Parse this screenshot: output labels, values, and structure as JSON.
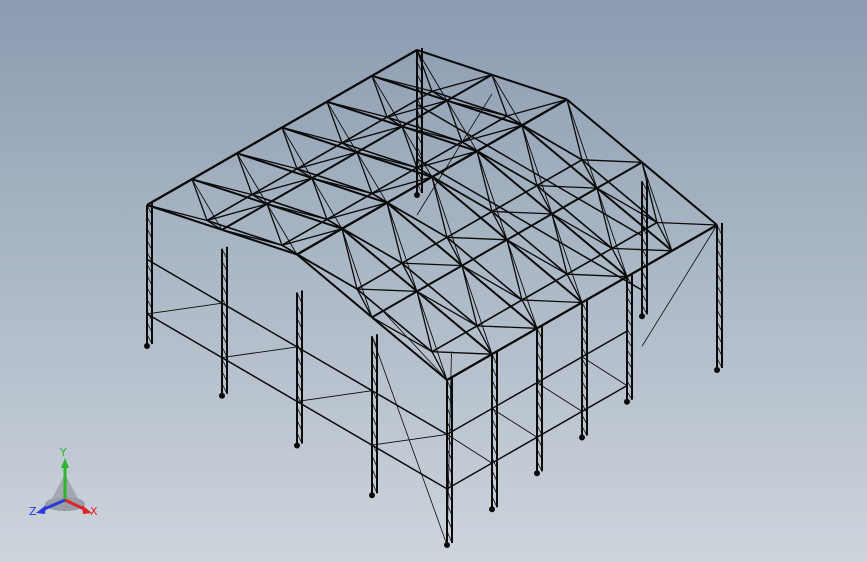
{
  "viewport": {
    "background_top": "#8b9bb0",
    "background_bottom": "#cdd4dc",
    "model_color": "#0a0a0a",
    "model_name": "steel-truss-building-frame"
  },
  "triad": {
    "x_label": "X",
    "y_label": "Y",
    "z_label": "Z",
    "x_color": "#e0232b",
    "y_color": "#2db52d",
    "z_color": "#2a3bd6"
  }
}
